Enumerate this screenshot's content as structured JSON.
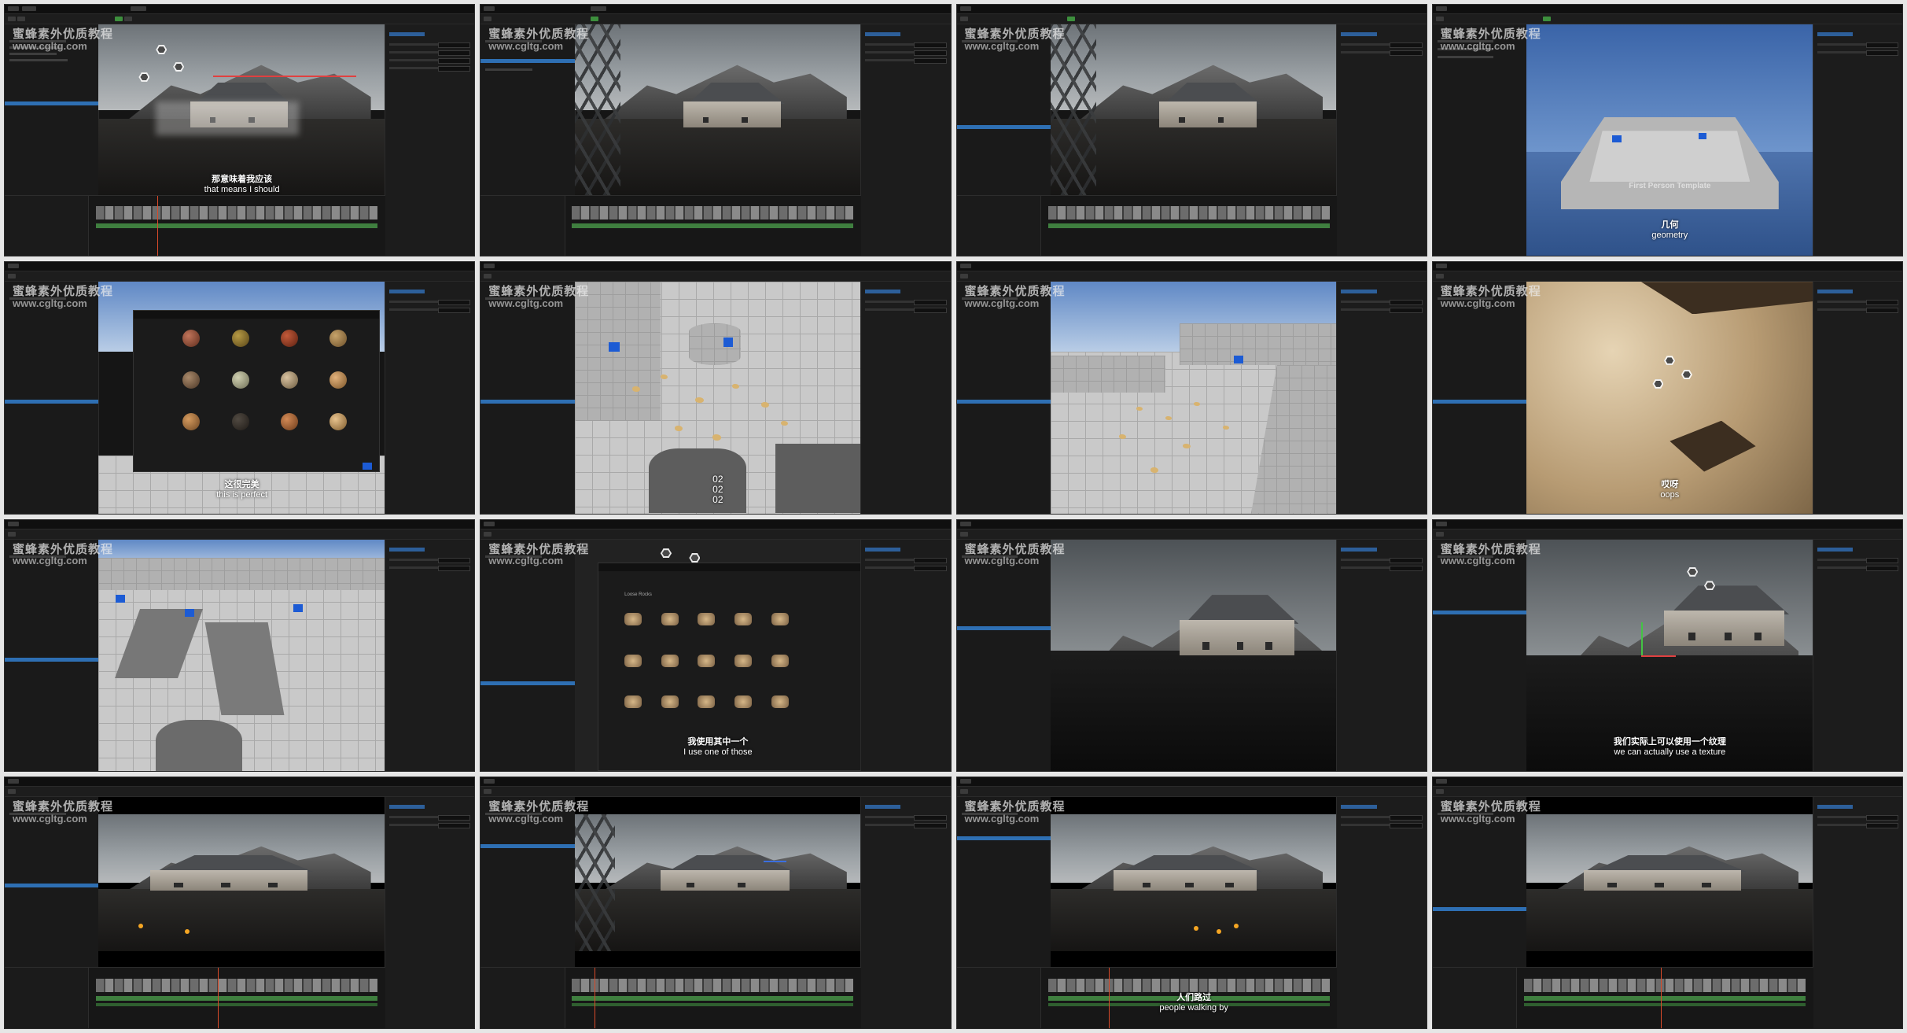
{
  "watermark": {
    "cn": "蜜蜂素外优质教程",
    "url": "www.cgltg.com"
  },
  "frames": [
    {
      "id": 1,
      "scene": "house-smoke",
      "subtitle": {
        "cn": "那意味着我应该",
        "en": "that means I should"
      }
    },
    {
      "id": 2,
      "scene": "house-scaffold"
    },
    {
      "id": 3,
      "scene": "house-scaffold"
    },
    {
      "id": 4,
      "scene": "first-person-template",
      "label": "First Person Template",
      "subtitle": {
        "cn": "几何",
        "en": "geometry"
      }
    },
    {
      "id": 5,
      "scene": "asset-browser-spheres",
      "subtitle": {
        "cn": "这很完美",
        "en": "this is perfect"
      }
    },
    {
      "id": 6,
      "scene": "rocks-grid",
      "numbers": [
        "02",
        "02",
        "02"
      ]
    },
    {
      "id": 7,
      "scene": "rocks-walls"
    },
    {
      "id": 8,
      "scene": "rock-closeup",
      "subtitle": {
        "cn": "哎呀",
        "en": "oops"
      }
    },
    {
      "id": 9,
      "scene": "grey-blocks"
    },
    {
      "id": 10,
      "scene": "asset-browser-rocks",
      "browser_section": "Loose Rocks",
      "subtitle": {
        "cn": "我使用其中一个",
        "en": "I use one of those"
      }
    },
    {
      "id": 11,
      "scene": "house-dark"
    },
    {
      "id": 12,
      "scene": "house-dark",
      "subtitle": {
        "cn": "我们实际上可以使用一个纹理",
        "en": "we can actually use a texture"
      }
    },
    {
      "id": 13,
      "scene": "house-timeline"
    },
    {
      "id": 14,
      "scene": "house-timeline-scaffold"
    },
    {
      "id": 15,
      "scene": "house-timeline",
      "subtitle": {
        "cn": "人们路过",
        "en": "people walking by"
      }
    },
    {
      "id": 16,
      "scene": "house-timeline"
    }
  ]
}
